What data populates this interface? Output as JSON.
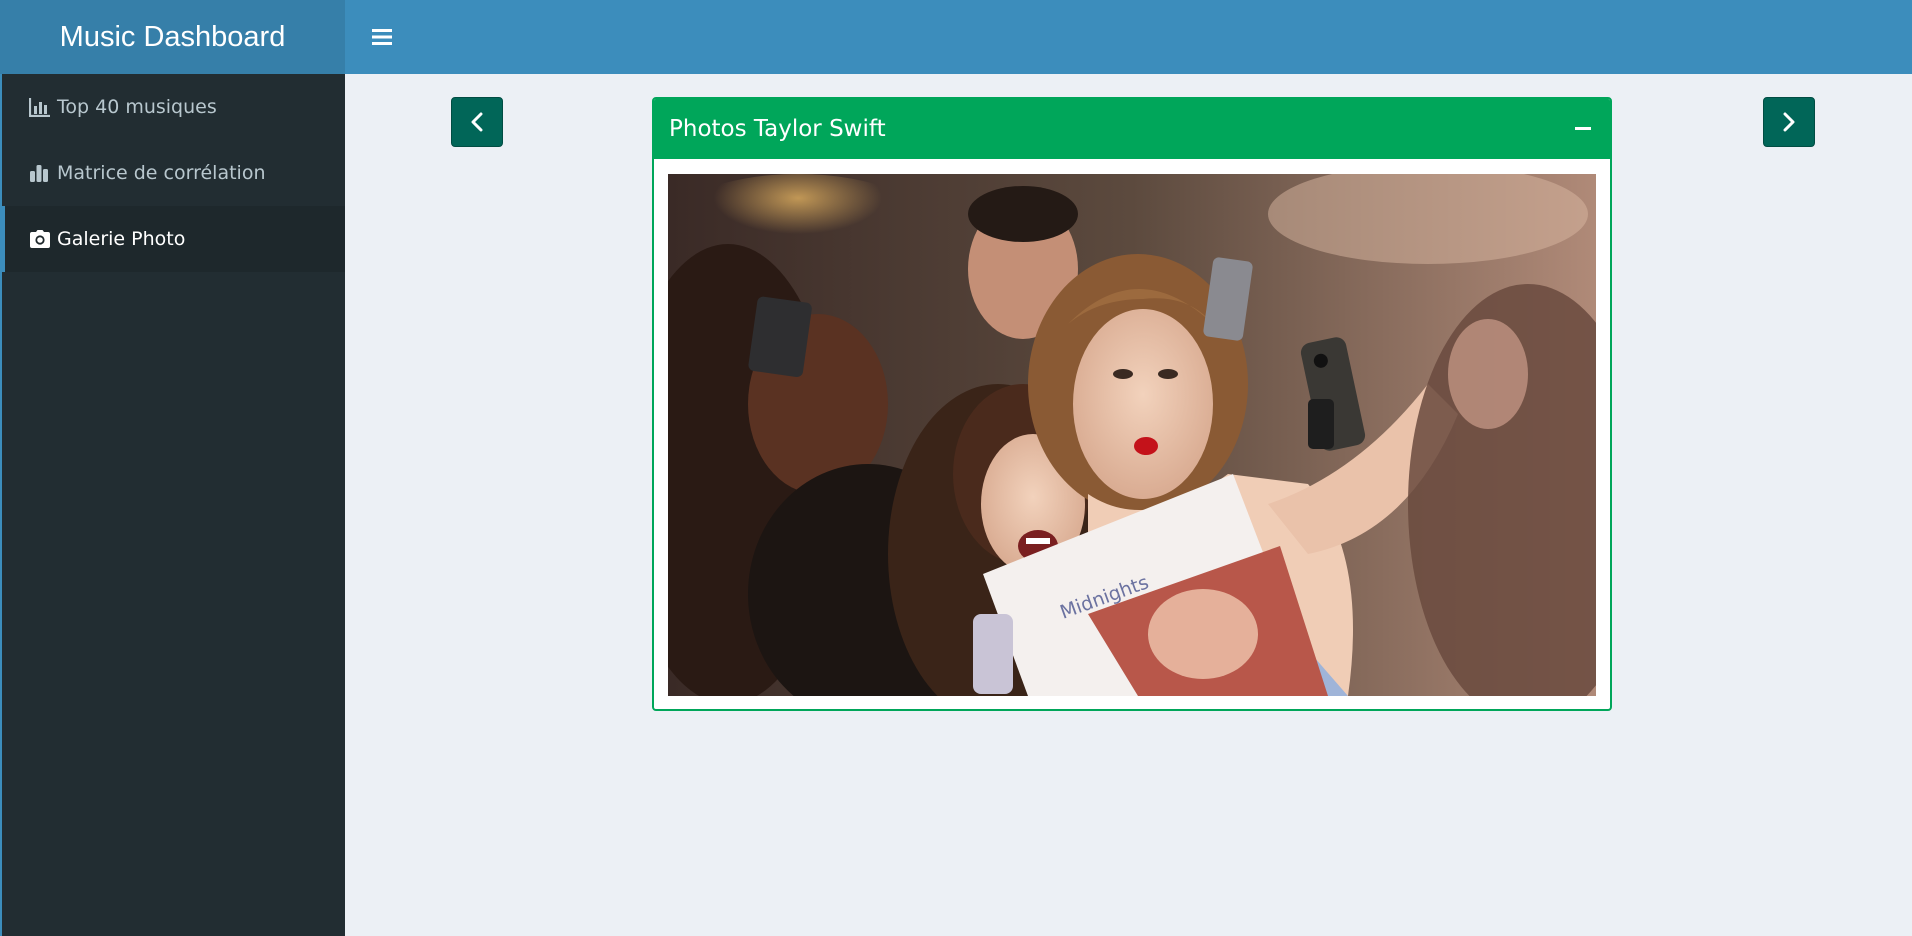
{
  "header": {
    "title": "Music Dashboard",
    "toggle_icon": "hamburger-icon"
  },
  "sidebar": {
    "items": [
      {
        "label": "Top 40 musiques",
        "icon": "bar-chart-icon",
        "active": false
      },
      {
        "label": "Matrice de corrélation",
        "icon": "column-chart-icon",
        "active": false
      },
      {
        "label": "Galerie Photo",
        "icon": "camera-icon",
        "active": true
      }
    ]
  },
  "gallery": {
    "title": "Photos Taylor Swift",
    "prev_icon": "chevron-left-icon",
    "next_icon": "chevron-right-icon",
    "collapse_icon": "minus-icon",
    "photo_text": "Midnights"
  },
  "colors": {
    "header_bg": "#3c8dbc",
    "logo_bg": "#367fa9",
    "sidebar_bg": "#222d32",
    "box_accent": "#00a65a",
    "nav_button": "#016658",
    "content_bg": "#ecf0f5"
  }
}
